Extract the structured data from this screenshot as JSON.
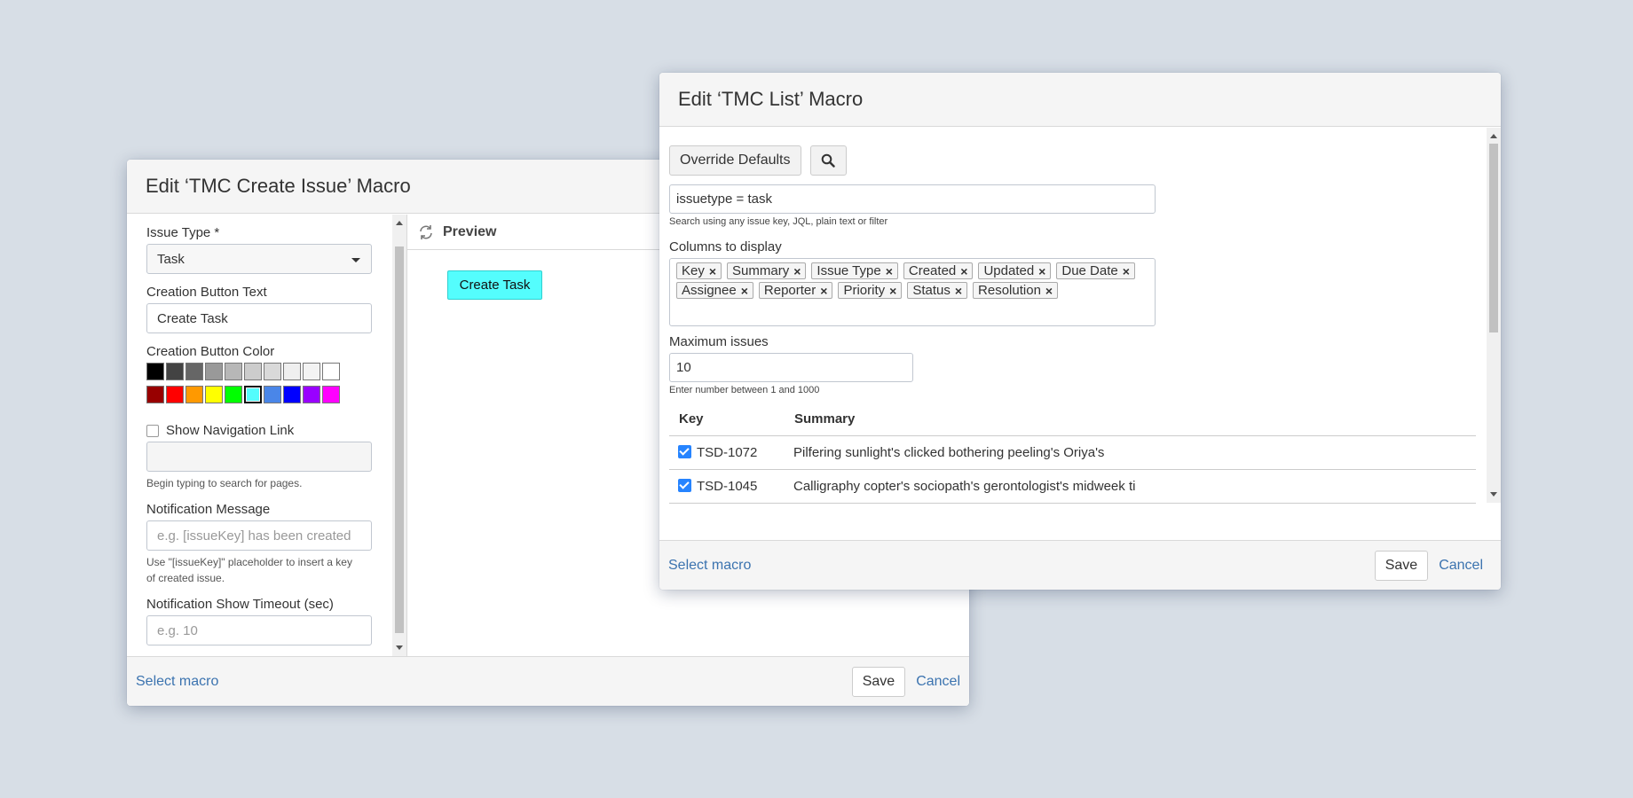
{
  "create_dialog": {
    "title": "Edit ‘TMC Create Issue’ Macro",
    "issue_type": {
      "label": "Issue Type *",
      "value": "Task"
    },
    "button_text": {
      "label": "Creation Button Text",
      "value": "Create Task"
    },
    "button_color": {
      "label": "Creation Button Color",
      "row1": [
        "#000000",
        "#434343",
        "#666666",
        "#999999",
        "#b7b7b7",
        "#cccccc",
        "#d9d9d9",
        "#efefef",
        "#f3f3f3",
        "#ffffff"
      ],
      "row2": [
        "#980000",
        "#ff0000",
        "#ff9900",
        "#ffff00",
        "#00ff00",
        "#54fdfd",
        "#4a86e8",
        "#0000ff",
        "#9900ff",
        "#ff00ff"
      ],
      "selected": "#54fdfd"
    },
    "navigation": {
      "label": "Show Navigation Link",
      "help": "Begin typing to search for pages."
    },
    "notification_message": {
      "label": "Notification Message",
      "placeholder": "e.g. [issueKey] has been created",
      "help": "Use \"[issueKey]\" placeholder to insert a key of created issue."
    },
    "notification_timeout": {
      "label": "Notification Show Timeout (sec)",
      "placeholder": "e.g. 10"
    },
    "preview": {
      "label": "Preview",
      "button_label": "Create Task",
      "button_color": "#54fdfd"
    },
    "footer": {
      "select_macro": "Select macro",
      "save": "Save",
      "cancel": "Cancel"
    }
  },
  "list_dialog": {
    "title": "Edit ‘TMC List’ Macro",
    "override_defaults": "Override Defaults",
    "search": {
      "value": "issuetype = task",
      "help": "Search using any issue key, JQL, plain text or filter"
    },
    "columns": {
      "label": "Columns to display",
      "tags": [
        "Key",
        "Summary",
        "Issue Type",
        "Created",
        "Updated",
        "Due Date",
        "Assignee",
        "Reporter",
        "Priority",
        "Status",
        "Resolution"
      ]
    },
    "max_issues": {
      "label": "Maximum issues",
      "value": "10",
      "help": "Enter number between 1 and 1000"
    },
    "table": {
      "headers": [
        "Key",
        "Summary"
      ],
      "rows": [
        {
          "key": "TSD-1072",
          "summary": "Pilfering sunlight's clicked bothering peeling's Oriya's"
        },
        {
          "key": "TSD-1045",
          "summary": "Calligraphy copter's sociopath's gerontologist's midweek ti"
        }
      ]
    },
    "footer": {
      "select_macro": "Select macro",
      "save": "Save",
      "cancel": "Cancel"
    }
  }
}
